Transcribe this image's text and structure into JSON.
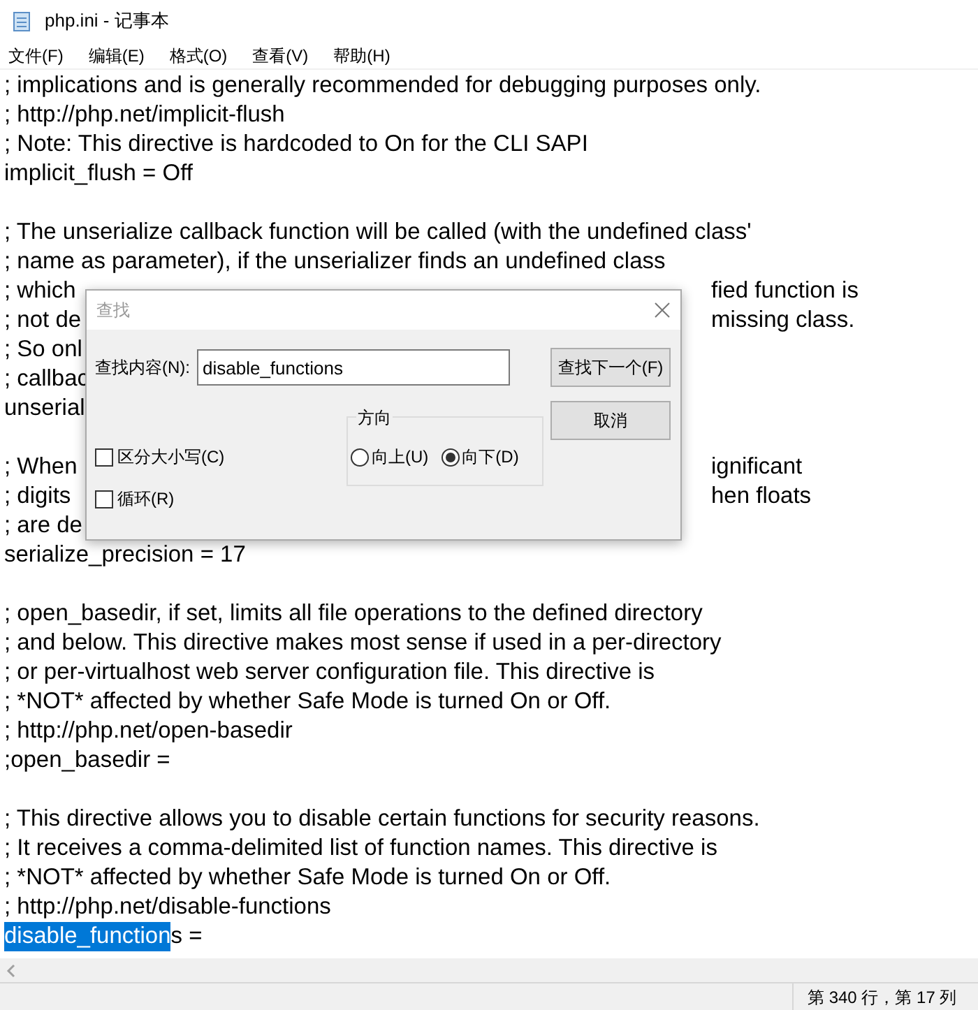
{
  "window": {
    "title": "php.ini - 记事本"
  },
  "menu": [
    "文件(F)",
    "编辑(E)",
    "格式(O)",
    "查看(V)",
    "帮助(H)"
  ],
  "lines": [
    {
      "kind": "plain",
      "text": "; implications and is generally recommended for debugging purposes only."
    },
    {
      "kind": "plain",
      "text": "; http://php.net/implicit-flush"
    },
    {
      "kind": "plain",
      "text": "; Note: This directive is hardcoded to On for the CLI SAPI"
    },
    {
      "kind": "plain",
      "text": "implicit_flush = Off"
    },
    {
      "kind": "blank"
    },
    {
      "kind": "plain",
      "text": "; The unserialize callback function will be called (with the undefined class'"
    },
    {
      "kind": "plain",
      "text": "; name as parameter), if the unserializer finds an undefined class"
    },
    {
      "kind": "covered",
      "left": "; which",
      "right": "fied function is"
    },
    {
      "kind": "covered",
      "left": "; not de",
      "right": "missing class."
    },
    {
      "kind": "covered",
      "left": "; So onl"
    },
    {
      "kind": "covered",
      "left": "; callbac"
    },
    {
      "kind": "covered",
      "left": "unserial"
    },
    {
      "kind": "blank"
    },
    {
      "kind": "covered",
      "left": "; When",
      "right": "ignificant"
    },
    {
      "kind": "covered",
      "left": "; digits",
      "right": "hen floats"
    },
    {
      "kind": "covered",
      "left": "; are de"
    },
    {
      "kind": "plain",
      "text": "serialize_precision = 17"
    },
    {
      "kind": "blank"
    },
    {
      "kind": "plain",
      "text": "; open_basedir, if set, limits all file operations to the defined directory"
    },
    {
      "kind": "plain",
      "text": "; and below.  This directive makes most sense if used in a per-directory"
    },
    {
      "kind": "plain",
      "text": "; or per-virtualhost web server configuration file. This directive is"
    },
    {
      "kind": "plain",
      "text": "; *NOT* affected by whether Safe Mode is turned On or Off."
    },
    {
      "kind": "plain",
      "text": "; http://php.net/open-basedir"
    },
    {
      "kind": "plain",
      "text": ";open_basedir ="
    },
    {
      "kind": "blank"
    },
    {
      "kind": "plain",
      "text": "; This directive allows you to disable certain functions for security reasons."
    },
    {
      "kind": "plain",
      "text": "; It receives a comma-delimited list of function names. This directive is"
    },
    {
      "kind": "plain",
      "text": "; *NOT* affected by whether Safe Mode is turned On or Off."
    },
    {
      "kind": "plain",
      "text": "; http://php.net/disable-functions"
    },
    {
      "kind": "selected",
      "selected_text": "disable_function",
      "rest": "s ="
    }
  ],
  "dialog": {
    "title": "查找",
    "find_label": "查找内容(N):",
    "find_value": "disable_functions",
    "buttons": [
      "查找下一个(F)",
      "取消"
    ],
    "direction": {
      "label": "方向",
      "options": [
        {
          "label": "向上(U)",
          "selected": false
        },
        {
          "label": "向下(D)",
          "selected": true
        }
      ]
    },
    "checkboxes": [
      {
        "label": "区分大小写(C)",
        "checked": false
      },
      {
        "label": "循环(R)",
        "checked": false
      }
    ]
  },
  "status_bar": {
    "position": "第 340 行，第 17 列"
  }
}
